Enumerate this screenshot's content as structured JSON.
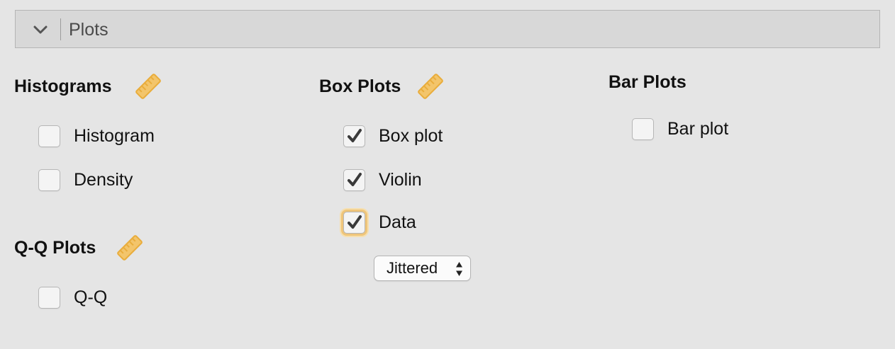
{
  "panel": {
    "title": "Plots",
    "expanded": true
  },
  "histograms": {
    "title": "Histograms",
    "options": [
      {
        "label": "Histogram",
        "checked": false
      },
      {
        "label": "Density",
        "checked": false
      }
    ]
  },
  "qq": {
    "title": "Q-Q Plots",
    "options": [
      {
        "label": "Q-Q",
        "checked": false
      }
    ]
  },
  "boxplots": {
    "title": "Box Plots",
    "options": [
      {
        "label": "Box plot",
        "checked": true
      },
      {
        "label": "Violin",
        "checked": true
      },
      {
        "label": "Data",
        "checked": true,
        "focused": true
      }
    ],
    "data_style_select": {
      "value": "Jittered"
    }
  },
  "barplots": {
    "title": "Bar Plots",
    "options": [
      {
        "label": "Bar plot",
        "checked": false
      }
    ]
  },
  "colors": {
    "ruler": "#e9ad3c",
    "focus_ring": "#efc57a",
    "check": "#3a3a3a"
  },
  "icons": {
    "collapse": "chevron-down-icon",
    "scale": "ruler-icon",
    "check": "checkmark-icon",
    "select": "up-down-arrows-icon"
  }
}
